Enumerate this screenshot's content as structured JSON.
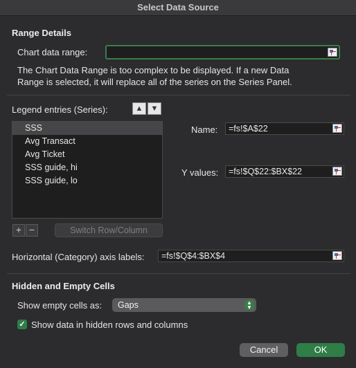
{
  "window": {
    "title": "Select Data Source"
  },
  "range_details": {
    "heading": "Range Details",
    "chart_range_label": "Chart data range:",
    "chart_range_value": "",
    "note_line1": "The Chart Data Range is too complex to be displayed. If a new Data",
    "note_line2": "Range is selected, it will replace all of the series on the Series Panel."
  },
  "series_panel": {
    "legend_label": "Legend entries (Series):",
    "move_up_icon": "arrow-up-icon",
    "move_down_icon": "arrow-down-icon",
    "items": [
      {
        "label": "SSS",
        "selected": true
      },
      {
        "label": "Avg Transact",
        "selected": false
      },
      {
        "label": "Avg Ticket",
        "selected": false
      },
      {
        "label": "SSS guide, hi",
        "selected": false
      },
      {
        "label": "SSS guide, lo",
        "selected": false
      }
    ],
    "add_label": "+",
    "remove_label": "−",
    "switch_label": "Switch Row/Column",
    "name_label": "Name:",
    "name_value": "=fs!$A$22",
    "yvalues_label": "Y values:",
    "yvalues_value": "=fs!$Q$22:$BX$22"
  },
  "axis": {
    "label": "Horizontal (Category) axis labels:",
    "value": "=fs!$Q$4:$BX$4"
  },
  "hidden_empty": {
    "heading": "Hidden and Empty Cells",
    "empty_label": "Show empty cells as:",
    "empty_value": "Gaps",
    "hidden_label": "Show data in hidden rows and columns",
    "hidden_checked": true
  },
  "footer": {
    "cancel_label": "Cancel",
    "ok_label": "OK"
  },
  "colors": {
    "accent_green": "#2f7d47",
    "background": "#2c2c2e"
  }
}
